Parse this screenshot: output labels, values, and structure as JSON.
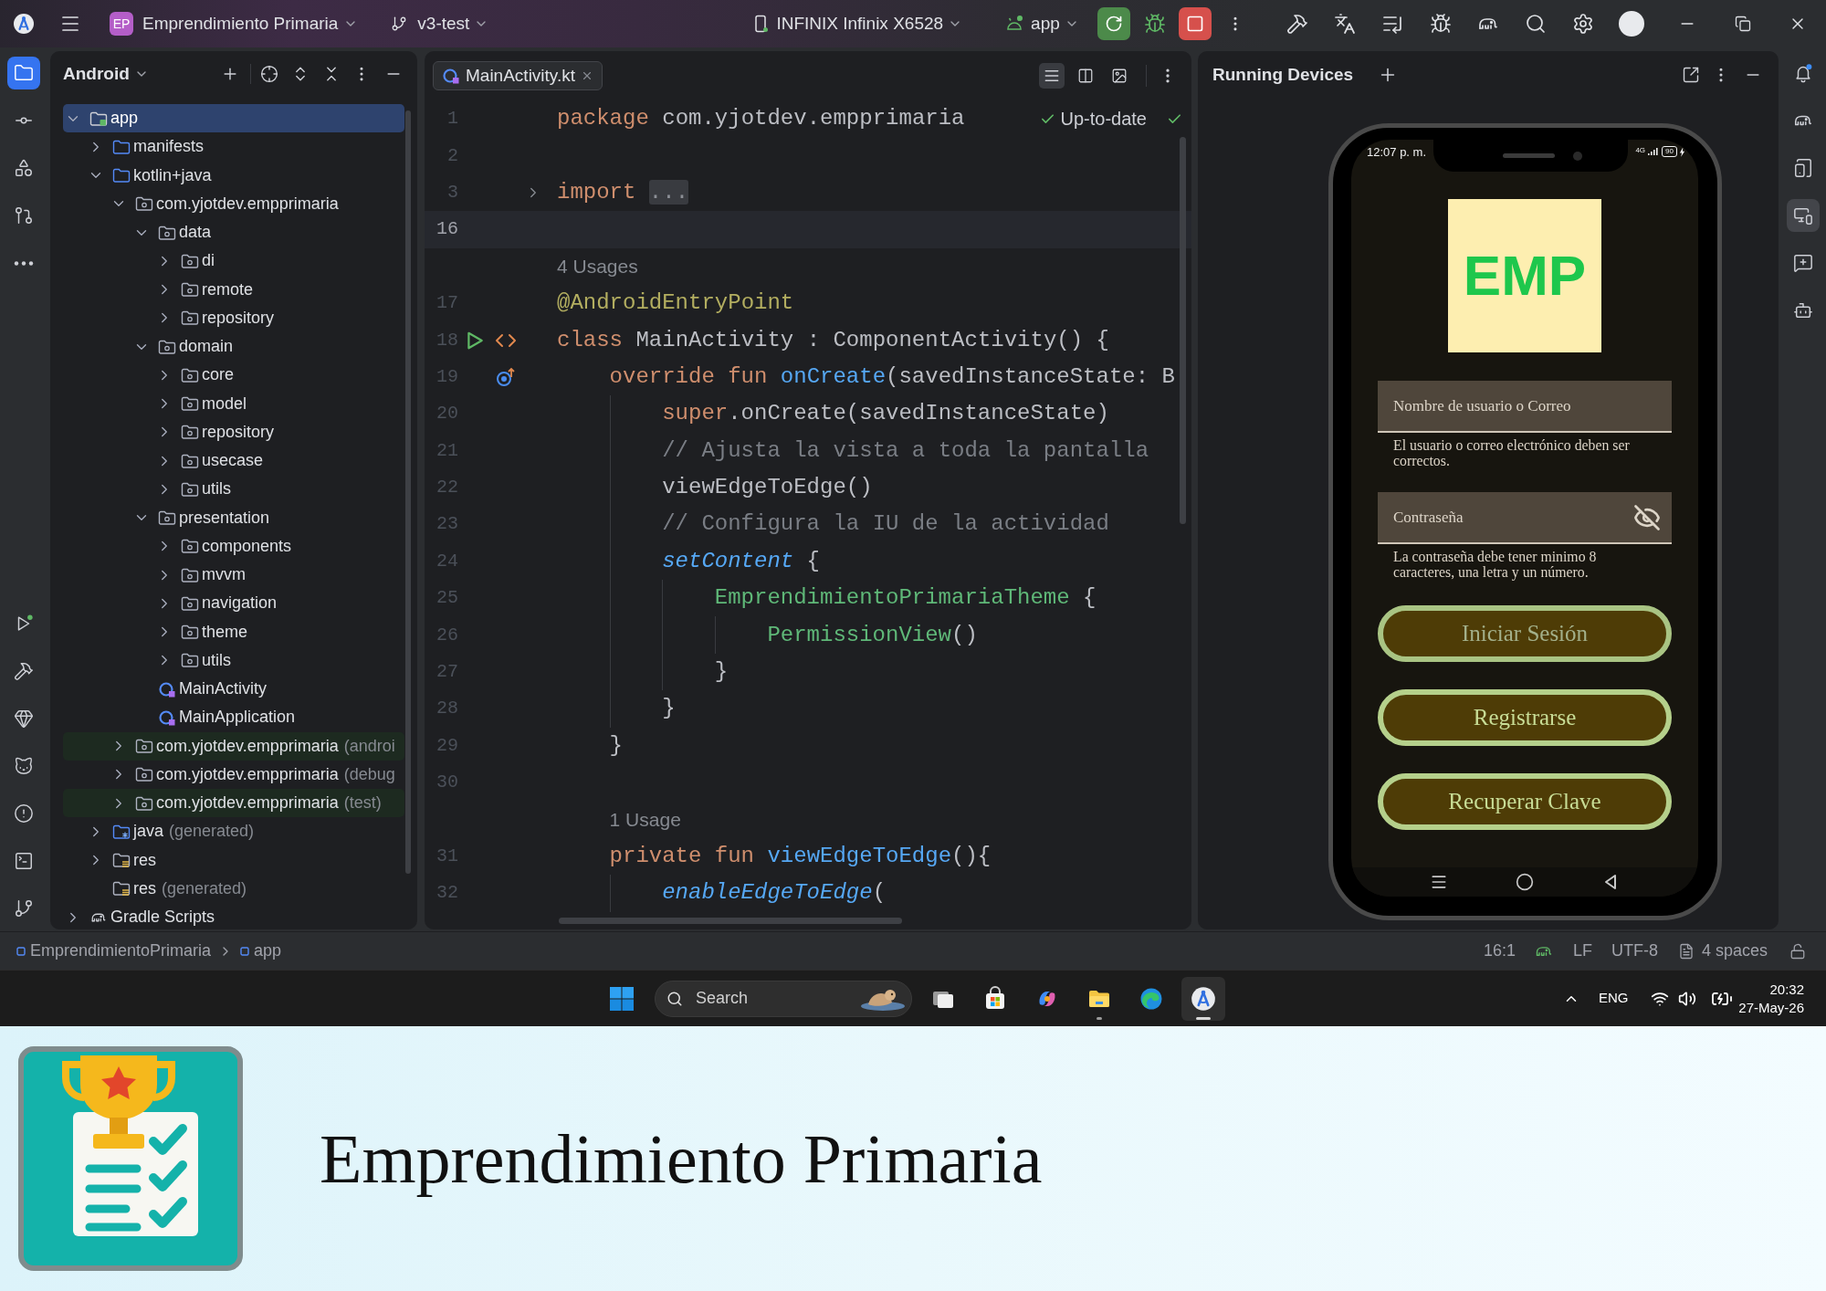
{
  "title_bar": {
    "project_badge": "EP",
    "project_name": "Emprendimiento Primaria",
    "branch": "v3-test",
    "device": "INFINIX Infinix X6528",
    "run_configuration": "app"
  },
  "left_toolbar": {
    "top": [
      {
        "kind": "project",
        "selected": true
      },
      {
        "kind": "commit",
        "selected": false
      },
      {
        "kind": "structure",
        "selected": false
      },
      {
        "kind": "pull-requests",
        "selected": false
      },
      {
        "kind": "more",
        "selected": false
      }
    ],
    "bottom": [
      {
        "kind": "run",
        "selected": false
      },
      {
        "kind": "build",
        "selected": false
      },
      {
        "kind": "gem",
        "selected": false
      },
      {
        "kind": "logcat",
        "selected": false
      },
      {
        "kind": "problems",
        "selected": false
      },
      {
        "kind": "terminal",
        "selected": false
      },
      {
        "kind": "git",
        "selected": false
      }
    ]
  },
  "project_panel": {
    "view": "Android",
    "tree": [
      {
        "label": "app",
        "kind": "module",
        "expanded": true,
        "selected": true,
        "children": [
          {
            "label": "manifests",
            "kind": "folder",
            "expanded": false,
            "selected": false
          },
          {
            "label": "kotlin+java",
            "kind": "folder",
            "expanded": true,
            "selected": false,
            "children": [
              {
                "label": "com.yjotdev.empprimaria",
                "kind": "package",
                "expanded": true,
                "selected": false,
                "children": [
                  {
                    "label": "data",
                    "kind": "package",
                    "expanded": true,
                    "selected": false,
                    "children": [
                      {
                        "label": "di",
                        "kind": "package",
                        "expanded": false,
                        "selected": false
                      },
                      {
                        "label": "remote",
                        "kind": "package",
                        "expanded": false,
                        "selected": false
                      },
                      {
                        "label": "repository",
                        "kind": "package",
                        "expanded": false,
                        "selected": false
                      }
                    ]
                  },
                  {
                    "label": "domain",
                    "kind": "package",
                    "expanded": true,
                    "selected": false,
                    "children": [
                      {
                        "label": "core",
                        "kind": "package",
                        "expanded": false,
                        "selected": false
                      },
                      {
                        "label": "model",
                        "kind": "package",
                        "expanded": false,
                        "selected": false
                      },
                      {
                        "label": "repository",
                        "kind": "package",
                        "expanded": false,
                        "selected": false
                      },
                      {
                        "label": "usecase",
                        "kind": "package",
                        "expanded": false,
                        "selected": false
                      },
                      {
                        "label": "utils",
                        "kind": "package",
                        "expanded": false,
                        "selected": false
                      }
                    ]
                  },
                  {
                    "label": "presentation",
                    "kind": "package",
                    "expanded": true,
                    "selected": false,
                    "children": [
                      {
                        "label": "components",
                        "kind": "package",
                        "expanded": false,
                        "selected": false
                      },
                      {
                        "label": "mvvm",
                        "kind": "package",
                        "expanded": false,
                        "selected": false
                      },
                      {
                        "label": "navigation",
                        "kind": "package",
                        "expanded": false,
                        "selected": false
                      },
                      {
                        "label": "theme",
                        "kind": "package",
                        "expanded": false,
                        "selected": false
                      },
                      {
                        "label": "utils",
                        "kind": "package",
                        "expanded": false,
                        "selected": false
                      }
                    ]
                  },
                  {
                    "label": "MainActivity",
                    "kind": "class",
                    "selected": false
                  },
                  {
                    "label": "MainApplication",
                    "kind": "class",
                    "selected": false
                  }
                ]
              },
              {
                "label": "com.yjotdev.empprimaria",
                "note": "(androi",
                "kind": "test-package",
                "expanded": false,
                "selected": false
              },
              {
                "label": "com.yjotdev.empprimaria",
                "note": "(debug",
                "kind": "package",
                "expanded": false,
                "selected": false
              },
              {
                "label": "com.yjotdev.empprimaria",
                "note": "(test)",
                "kind": "test-package",
                "expanded": false,
                "selected": false
              }
            ]
          },
          {
            "label": "java",
            "note": "(generated)",
            "kind": "generated-folder",
            "expanded": false,
            "selected": false
          },
          {
            "label": "res",
            "kind": "resources",
            "expanded": false,
            "selected": false
          },
          {
            "label": "res",
            "note": "(generated)",
            "kind": "resources",
            "selected": false
          }
        ]
      },
      {
        "label": "Gradle Scripts",
        "kind": "gradle",
        "expanded": false,
        "selected": false
      }
    ]
  },
  "editor": {
    "tabs": [
      {
        "label": "MainActivity.kt",
        "selected": true
      }
    ],
    "view_modes": [
      {
        "kind": "code",
        "selected": true
      },
      {
        "kind": "split",
        "selected": false
      },
      {
        "kind": "design",
        "selected": false
      }
    ],
    "inspection_status": "Up-to-date",
    "lines": [
      {
        "kind": "code",
        "number": "1",
        "current": false,
        "tokens": [
          {
            "kind": "keyword",
            "text": "package"
          },
          {
            "kind": "plain",
            "text": " com.yjotdev.empprimaria"
          }
        ]
      },
      {
        "kind": "code",
        "number": "2",
        "current": false
      },
      {
        "kind": "code",
        "number": "3",
        "current": false,
        "gutter": [
          {
            "kind": "fold"
          }
        ],
        "tokens": [
          {
            "kind": "keyword",
            "text": "import "
          },
          {
            "kind": "folded",
            "text": "..."
          }
        ]
      },
      {
        "kind": "code",
        "number": "16",
        "current": true
      },
      {
        "kind": "hint",
        "text": "4 Usages"
      },
      {
        "kind": "code",
        "number": "17",
        "current": false,
        "tokens": [
          {
            "kind": "annotation",
            "text": "@AndroidEntryPoint"
          }
        ]
      },
      {
        "kind": "code",
        "number": "18",
        "current": false,
        "gutter": [
          {
            "kind": "run"
          },
          {
            "kind": "markup"
          }
        ],
        "tokens": [
          {
            "kind": "keyword",
            "text": "class"
          },
          {
            "kind": "plain",
            "text": " MainActivity : ComponentActivity() {"
          }
        ]
      },
      {
        "kind": "code",
        "number": "19",
        "current": false,
        "gutter": [
          {
            "kind": "override"
          }
        ],
        "tokens": [
          {
            "kind": "keyword",
            "text": "    override fun "
          },
          {
            "kind": "function",
            "text": "onCreate"
          },
          {
            "kind": "plain",
            "text": "(savedInstanceState: B"
          }
        ]
      },
      {
        "kind": "code",
        "number": "20",
        "current": false,
        "tokens": [
          {
            "kind": "keyword",
            "text": "        super"
          },
          {
            "kind": "plain",
            "text": ".onCreate(savedInstanceState)"
          }
        ]
      },
      {
        "kind": "code",
        "number": "21",
        "current": false,
        "tokens": [
          {
            "kind": "comment",
            "text": "        // Ajusta la vista a toda la pantalla"
          }
        ]
      },
      {
        "kind": "code",
        "number": "22",
        "current": false,
        "tokens": [
          {
            "kind": "plain",
            "text": "        viewEdgeToEdge()"
          }
        ]
      },
      {
        "kind": "code",
        "number": "23",
        "current": false,
        "tokens": [
          {
            "kind": "comment",
            "text": "        // Configura la IU de la actividad"
          }
        ]
      },
      {
        "kind": "code",
        "number": "24",
        "current": false,
        "tokens": [
          {
            "kind": "extension",
            "text": "        setContent"
          },
          {
            "kind": "plain",
            "text": " {"
          }
        ]
      },
      {
        "kind": "code",
        "number": "25",
        "current": false,
        "tokens": [
          {
            "kind": "composable",
            "text": "            EmprendimientoPrimariaTheme"
          },
          {
            "kind": "plain",
            "text": " {"
          }
        ]
      },
      {
        "kind": "code",
        "number": "26",
        "current": false,
        "tokens": [
          {
            "kind": "composable",
            "text": "                PermissionView"
          },
          {
            "kind": "plain",
            "text": "()"
          }
        ]
      },
      {
        "kind": "code",
        "number": "27",
        "current": false,
        "tokens": [
          {
            "kind": "plain",
            "text": "            }"
          }
        ]
      },
      {
        "kind": "code",
        "number": "28",
        "current": false,
        "tokens": [
          {
            "kind": "plain",
            "text": "        }"
          }
        ]
      },
      {
        "kind": "code",
        "number": "29",
        "current": false,
        "tokens": [
          {
            "kind": "plain",
            "text": "    }"
          }
        ]
      },
      {
        "kind": "code",
        "number": "30",
        "current": false
      },
      {
        "kind": "hint",
        "text": "1 Usage"
      },
      {
        "kind": "code",
        "number": "31",
        "current": false,
        "tokens": [
          {
            "kind": "keyword",
            "text": "    private fun "
          },
          {
            "kind": "function",
            "text": "viewEdgeToEdge"
          },
          {
            "kind": "plain",
            "text": "(){"
          }
        ]
      },
      {
        "kind": "code",
        "number": "32",
        "current": false,
        "tokens": [
          {
            "kind": "extension",
            "text": "        enableEdgeToEdge"
          },
          {
            "kind": "plain",
            "text": "("
          }
        ]
      }
    ]
  },
  "running_devices": {
    "title": "Running Devices",
    "phone": {
      "time": "12:07 p. m.",
      "network": "4G",
      "battery": "90",
      "logo": "EMP",
      "fields": [
        {
          "kind": "text",
          "placeholder": "Nombre de usuario o Correo",
          "helper": "El usuario o correo electrónico deben ser correctos."
        },
        {
          "kind": "password",
          "placeholder": "Contraseña",
          "helper": "La contraseña debe tener minimo 8 caracteres, una letra y un número."
        }
      ],
      "buttons": [
        {
          "label": "Iniciar Sesión",
          "disabled": true
        },
        {
          "label": "Registrarse",
          "disabled": false
        },
        {
          "label": "Recuperar Clave",
          "disabled": false
        }
      ]
    }
  },
  "right_toolbar": [
    {
      "kind": "notifications",
      "selected": false
    },
    {
      "kind": "gradle",
      "selected": false
    },
    {
      "kind": "device-manager",
      "selected": false
    },
    {
      "kind": "running-devices",
      "selected": true
    },
    {
      "kind": "device-chat",
      "selected": false
    },
    {
      "kind": "assistant",
      "selected": false
    }
  ],
  "status_bar": {
    "breadcrumbs": [
      "EmprendimientoPrimaria",
      "app"
    ],
    "caret_position": "16:1",
    "line_separator": "LF",
    "encoding": "UTF-8",
    "indentation": "4 spaces"
  },
  "taskbar": {
    "search": {
      "placeholder": "Search"
    },
    "apps": [
      {
        "kind": "task-view",
        "running": false,
        "selected": false
      },
      {
        "kind": "store",
        "running": false,
        "selected": false
      },
      {
        "kind": "copilot",
        "running": false,
        "selected": false
      },
      {
        "kind": "file-explorer",
        "running": true,
        "selected": false
      },
      {
        "kind": "edge",
        "running": false,
        "selected": false
      },
      {
        "kind": "android-studio",
        "running": true,
        "selected": true
      }
    ],
    "language": "ENG",
    "time": "20:32",
    "date": "27-May-26"
  },
  "banner": {
    "title": "Emprendimiento Primaria"
  }
}
